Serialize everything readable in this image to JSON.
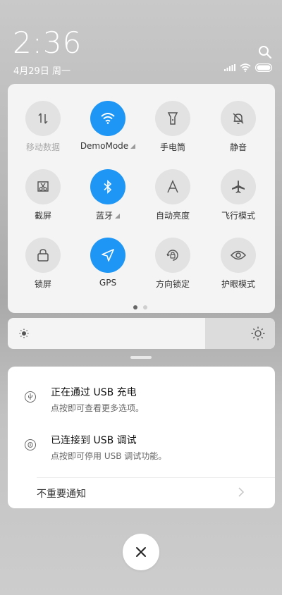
{
  "status": {
    "time": "2:36",
    "date": "4月29日 周一"
  },
  "quick_settings": {
    "tiles": [
      {
        "label": "移动数据",
        "icon": "mobile-data-icon",
        "state": "off",
        "dim": true
      },
      {
        "label": "DemoMode",
        "icon": "wifi-icon",
        "state": "on"
      },
      {
        "label": "手电筒",
        "icon": "flashlight-icon",
        "state": "off"
      },
      {
        "label": "静音",
        "icon": "mute-bell-icon",
        "state": "off"
      },
      {
        "label": "截屏",
        "icon": "screenshot-icon",
        "state": "off"
      },
      {
        "label": "蓝牙",
        "icon": "bluetooth-icon",
        "state": "on"
      },
      {
        "label": "自动亮度",
        "icon": "auto-brightness-icon",
        "state": "off"
      },
      {
        "label": "飞行模式",
        "icon": "airplane-icon",
        "state": "off"
      },
      {
        "label": "锁屏",
        "icon": "lock-icon",
        "state": "off"
      },
      {
        "label": "GPS",
        "icon": "gps-icon",
        "state": "on"
      },
      {
        "label": "方向锁定",
        "icon": "rotation-lock-icon",
        "state": "off"
      },
      {
        "label": "护眼模式",
        "icon": "eye-icon",
        "state": "off"
      }
    ],
    "page_count": 2,
    "current_page": 1
  },
  "brightness": {
    "level": 0.74
  },
  "notifications": [
    {
      "title": "正在通过 USB 充电",
      "subtitle": "点按即可查看更多选项。",
      "icon": "usb-charge-icon"
    },
    {
      "title": "已连接到 USB 调试",
      "subtitle": "点按即可停用 USB 调试功能。",
      "icon": "usb-debug-icon"
    }
  ],
  "unimportant_label": "不重要通知",
  "colors": {
    "accent": "#1e96f5",
    "tile_off": "#e2e2e2",
    "panel": "#f4f4f4"
  }
}
